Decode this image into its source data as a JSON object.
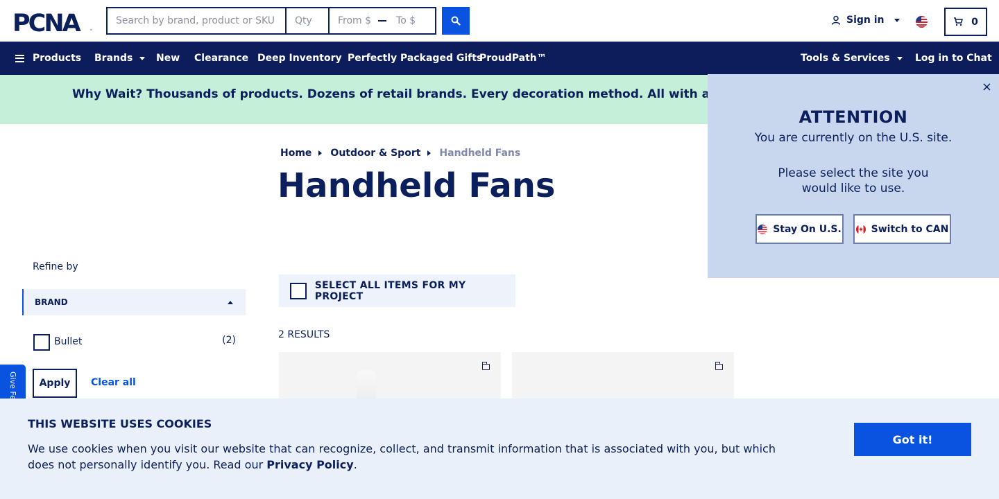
{
  "header": {
    "logo_text": "PCNA",
    "search": {
      "placeholder": "Search by brand, product or SKU",
      "qty_placeholder": "Qty",
      "price_from_placeholder": "From $",
      "price_to_placeholder": "To $"
    },
    "signin_label": "Sign in",
    "cart_count": "0"
  },
  "nav": {
    "products": "Products",
    "brands": "Brands",
    "new": "New",
    "clearance": "Clearance",
    "deep_inventory": "Deep Inventory",
    "gifts": "Perfectly Packaged Gifts",
    "proudpath": "ProudPath™",
    "tools": "Tools & Services",
    "chat": "Log in to Chat"
  },
  "banner": {
    "text": "Why Wait? Thousands of products. Dozens of retail brands. Every decoration method. All with a standard"
  },
  "breadcrumb": {
    "home": "Home",
    "category": "Outdoor & Sport",
    "current": "Handheld Fans"
  },
  "page": {
    "title": "Handheld Fans",
    "select_all": "SELECT ALL ITEMS FOR MY PROJECT",
    "results": "2 RESULTS"
  },
  "sidebar": {
    "refine_by": "Refine by",
    "brand_heading": "BRAND",
    "options": [
      {
        "label": "Bullet",
        "count": "(2)"
      }
    ],
    "apply": "Apply",
    "clear_all": "Clear all",
    "feedback": "Give Fe"
  },
  "attention": {
    "heading": "ATTENTION",
    "line1": "You are currently on the U.S. site.",
    "line2": "Please select the site you would like to use.",
    "stay_label": "Stay On U.S.",
    "switch_label": "Switch to CAN",
    "close": "×"
  },
  "cookies": {
    "heading": "THIS WEBSITE USES COOKIES",
    "text": "We use cookies when you visit our website that can recognize, collect, and transmit information that is associated with you, but which does not personally identify you. Read our ",
    "link": "Privacy Policy",
    "end": ".",
    "button": "Got it!"
  },
  "colors": {
    "navy": "#0d1d5b",
    "accent_blue": "#0a52e0",
    "banner_green": "#c5efd8",
    "popup_blue": "#c8d6ee",
    "cookie_bg": "#eaf0fa"
  }
}
